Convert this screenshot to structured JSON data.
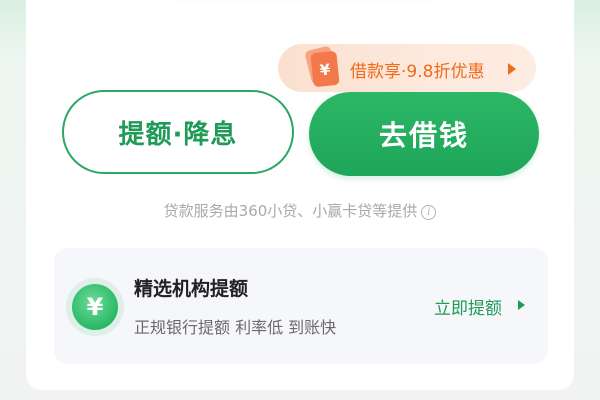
{
  "promo": {
    "icon": "red-envelope-yen-icon",
    "text": "借款享·9.8折优惠",
    "arrow": "triangle-right-icon"
  },
  "actions": {
    "raise_limit_label": "提额·降息",
    "borrow_label": "去借钱"
  },
  "disclaimer": {
    "text": "贷款服务由360小贷、小赢卡贷等提供",
    "info_icon": "info-icon"
  },
  "offer": {
    "icon": "yen-badge-icon",
    "title": "精选机构提额",
    "subtitle": "正规银行提额 利率低 到账快",
    "link_label": "立即提额"
  },
  "colors": {
    "brand_green": "#1f9a57",
    "promo_orange": "#f26a1b"
  }
}
